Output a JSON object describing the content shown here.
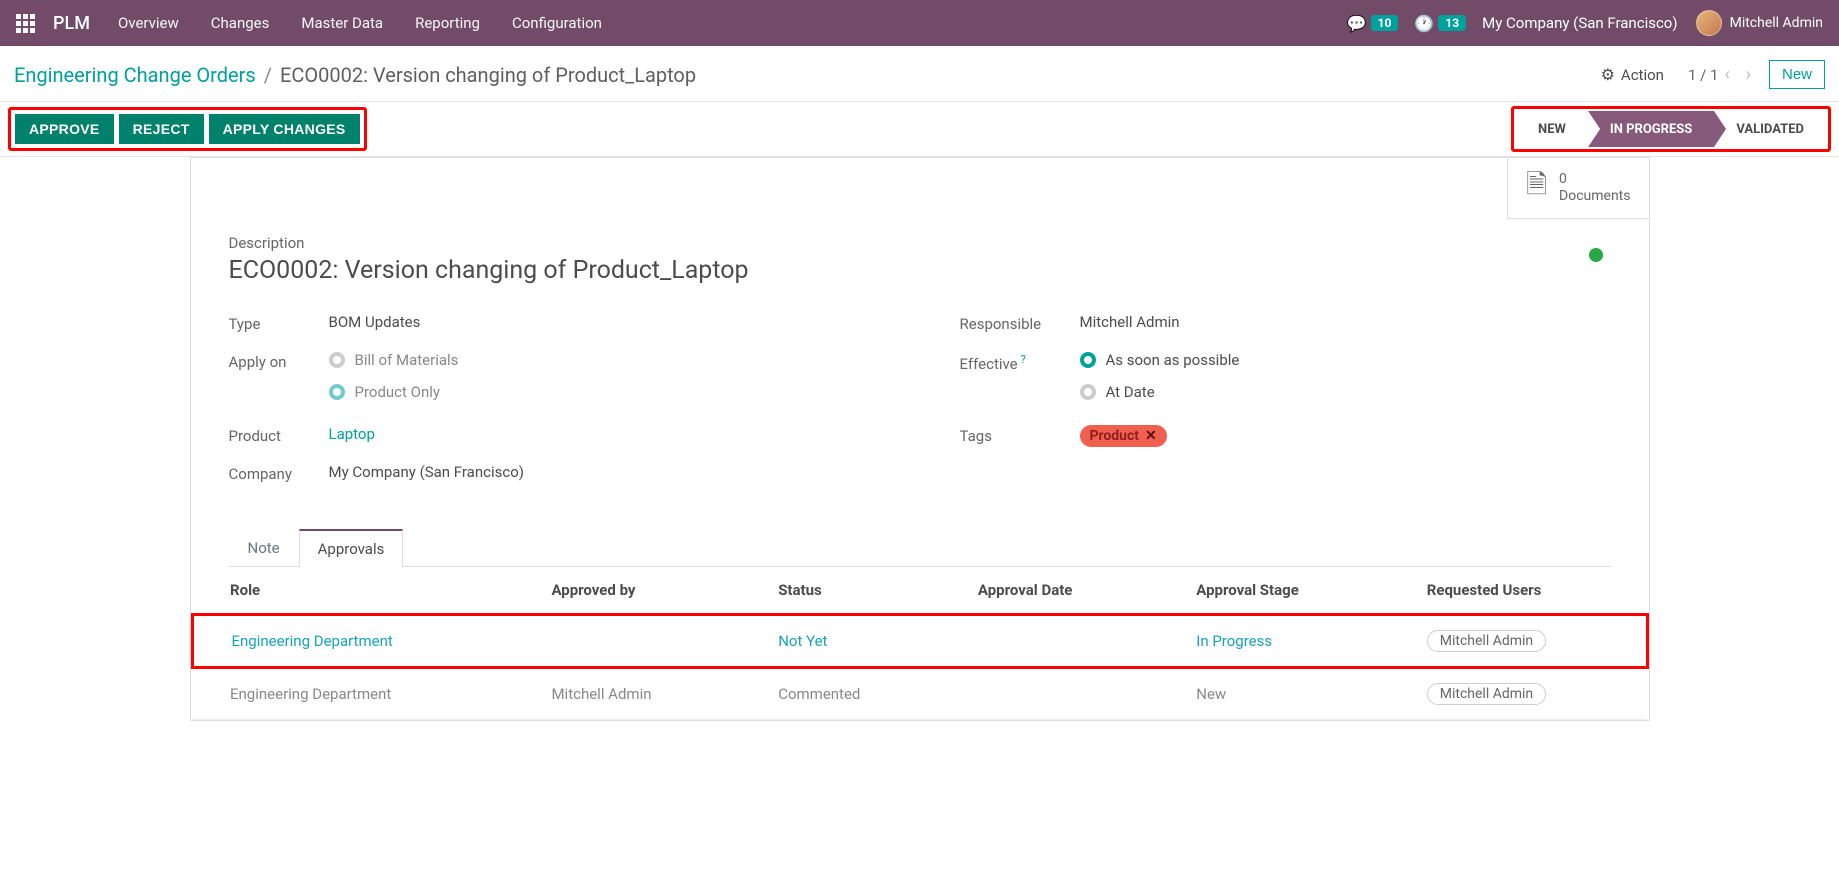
{
  "navbar": {
    "brand": "PLM",
    "links": [
      "Overview",
      "Changes",
      "Master Data",
      "Reporting",
      "Configuration"
    ],
    "messages_badge": "10",
    "activities_badge": "13",
    "company": "My Company (San Francisco)",
    "user": "Mitchell Admin"
  },
  "breadcrumb": {
    "root": "Engineering Change Orders",
    "current": "ECO0002: Version changing of Product_Laptop"
  },
  "controls": {
    "action_label": "Action",
    "pager": "1 / 1",
    "new_button": "New"
  },
  "buttons": {
    "approve": "APPROVE",
    "reject": "REJECT",
    "apply": "APPLY CHANGES"
  },
  "stages": {
    "s1": "NEW",
    "s2": "IN PROGRESS",
    "s3": "VALIDATED"
  },
  "docbox": {
    "count": "0",
    "label": "Documents"
  },
  "form": {
    "desc_label": "Description",
    "title": "ECO0002: Version changing of Product_Laptop",
    "labels": {
      "type": "Type",
      "apply_on": "Apply on",
      "product": "Product",
      "company": "Company",
      "responsible": "Responsible",
      "effective": "Effective",
      "tags": "Tags"
    },
    "type_value": "BOM Updates",
    "apply_on": {
      "opt1": "Bill of Materials",
      "opt2": "Product Only"
    },
    "product": "Laptop",
    "company": "My Company (San Francisco)",
    "responsible": "Mitchell Admin",
    "effective": {
      "opt1": "As soon as possible",
      "opt2": "At Date"
    },
    "tag": "Product"
  },
  "tabs": {
    "note": "Note",
    "approvals": "Approvals"
  },
  "table": {
    "headers": {
      "role": "Role",
      "approved_by": "Approved by",
      "status": "Status",
      "approval_date": "Approval Date",
      "approval_stage": "Approval Stage",
      "requested_users": "Requested Users"
    },
    "rows": [
      {
        "role": "Engineering Department",
        "approved_by": "",
        "status": "Not Yet",
        "date": "",
        "stage": "In Progress",
        "user": "Mitchell Admin",
        "linked": true
      },
      {
        "role": "Engineering Department",
        "approved_by": "Mitchell Admin",
        "status": "Commented",
        "date": "",
        "stage": "New",
        "user": "Mitchell Admin",
        "linked": false
      }
    ]
  }
}
